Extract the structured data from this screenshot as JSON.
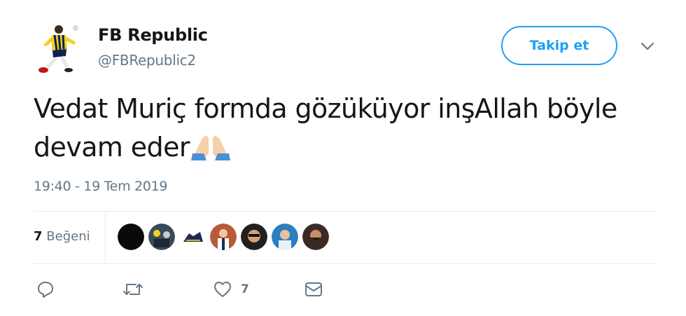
{
  "author": {
    "name": "FB Republic",
    "handle": "@FBRepublic2"
  },
  "follow_button": {
    "label": "Takip et"
  },
  "tweet": {
    "text_line1": "Vedat Muriç formda gözüküyor inşAllah böyle",
    "text_line2": "devam eder",
    "emoji": "folded-hands-icon",
    "timestamp": "19:40 - 19 Tem 2019"
  },
  "stats": {
    "likes_count": "7",
    "likes_label": "Beğeni",
    "liker_avatars": 7
  },
  "actions": {
    "reply": "reply-icon",
    "retweet": "retweet-icon",
    "like": "heart-icon",
    "like_count": "7",
    "dm": "envelope-icon"
  },
  "colors": {
    "accent": "#1da1f2",
    "muted": "#657786",
    "divider": "#e6ecf0"
  }
}
